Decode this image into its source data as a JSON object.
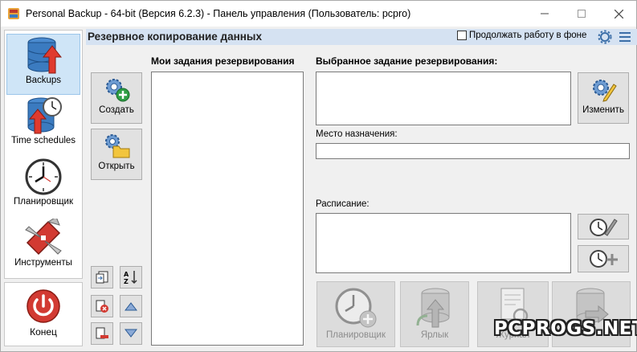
{
  "window": {
    "title": "Personal Backup - 64-bit (Версия 6.2.3) - Панель управления (Пользователь: pcpro)",
    "icons": [
      "app-icon",
      "minimize-icon",
      "maximize-icon",
      "close-icon"
    ]
  },
  "sidebar": {
    "items": [
      {
        "label": "Backups",
        "icon": "database-upload-icon",
        "selected": true
      },
      {
        "label": "Time schedules",
        "icon": "database-clock-icon",
        "selected": false
      },
      {
        "label": "Планировщик",
        "icon": "clock-icon",
        "selected": false
      },
      {
        "label": "Инструменты",
        "icon": "tools-knife-icon",
        "selected": false
      }
    ],
    "exit": {
      "label": "Конец",
      "icon": "power-icon"
    }
  },
  "header": {
    "title": "Резервное копирование данных",
    "keep_working_label": "Продолжать работу в фоне",
    "keep_working_checked": false
  },
  "tools": {
    "create_label": "Создать",
    "open_label": "Открыть"
  },
  "panels": {
    "my_tasks_label": "Мои задания резервирования",
    "selected_task_label": "Выбранное задание резервирования:",
    "edit_label": "Изменить",
    "destination_label": "Место назначения:",
    "destination_value": "",
    "schedule_label": "Расписание:"
  },
  "bottom_buttons": [
    {
      "label": "Планировщик",
      "enabled": false
    },
    {
      "label": "Ярлык",
      "enabled": false
    },
    {
      "label": "Журнал",
      "enabled": false
    },
    {
      "label": "",
      "enabled": false
    }
  ],
  "watermark": "PCPROGS.NET",
  "colors": {
    "accent": "#cfe5f7",
    "header_bg": "#d5e2f2",
    "danger": "#d23a32",
    "disk": "#3b7bc0"
  }
}
